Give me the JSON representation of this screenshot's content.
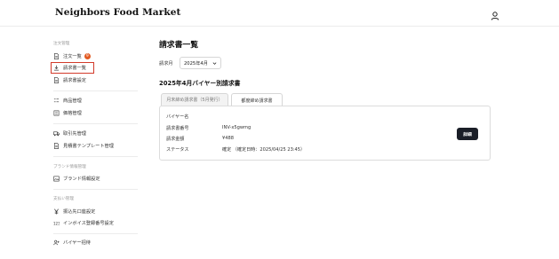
{
  "header": {
    "brand": "Neighbors Food Market",
    "user_icon": "user-icon"
  },
  "sidebar": {
    "sections": [
      {
        "title": "注文管理",
        "items": [
          {
            "label": "注文一覧",
            "icon": "document-icon",
            "badge": "9"
          },
          {
            "label": "請求書一覧",
            "icon": "download-icon",
            "active": true
          },
          {
            "label": "請求書設定",
            "icon": "document-icon"
          }
        ]
      },
      {
        "title": "",
        "items": [
          {
            "label": "商品管理",
            "icon": "list-icon"
          },
          {
            "label": "価格管理",
            "icon": "tag-icon"
          }
        ]
      },
      {
        "title": "",
        "items": [
          {
            "label": "取引先管理",
            "icon": "truck-icon"
          },
          {
            "label": "見積書テンプレート管理",
            "icon": "document-icon"
          }
        ]
      },
      {
        "title": "ブランド情報管理",
        "items": [
          {
            "label": "ブランド情報設定",
            "icon": "image-icon"
          }
        ]
      },
      {
        "title": "支払い管理",
        "items": [
          {
            "label": "振込先口座設定",
            "icon": "yen-icon"
          },
          {
            "label": "インボイス登録番号設定",
            "icon": "number-icon"
          }
        ]
      },
      {
        "title": "",
        "items": [
          {
            "label": "バイヤー招待",
            "icon": "user-plus-icon"
          }
        ]
      }
    ]
  },
  "main": {
    "title": "請求書一覧",
    "filter": {
      "label": "請求月",
      "value": "2025年4月"
    },
    "section_title": "2025年4月バイヤー別請求書",
    "tabs": [
      {
        "label": "月末締め請求書（5月発行）",
        "active": false
      },
      {
        "label": "都度締め請求書",
        "active": true
      }
    ],
    "invoice": {
      "rows": [
        {
          "label": "バイヤー名",
          "value": ""
        },
        {
          "label": "請求書番号",
          "value": "INV-x5gwmg"
        },
        {
          "label": "請求金額",
          "value": "¥488"
        },
        {
          "label": "ステータス",
          "value": "確定 （確定日時：2025/04/25 23:45）"
        }
      ],
      "detail_button": "詳細"
    }
  }
}
